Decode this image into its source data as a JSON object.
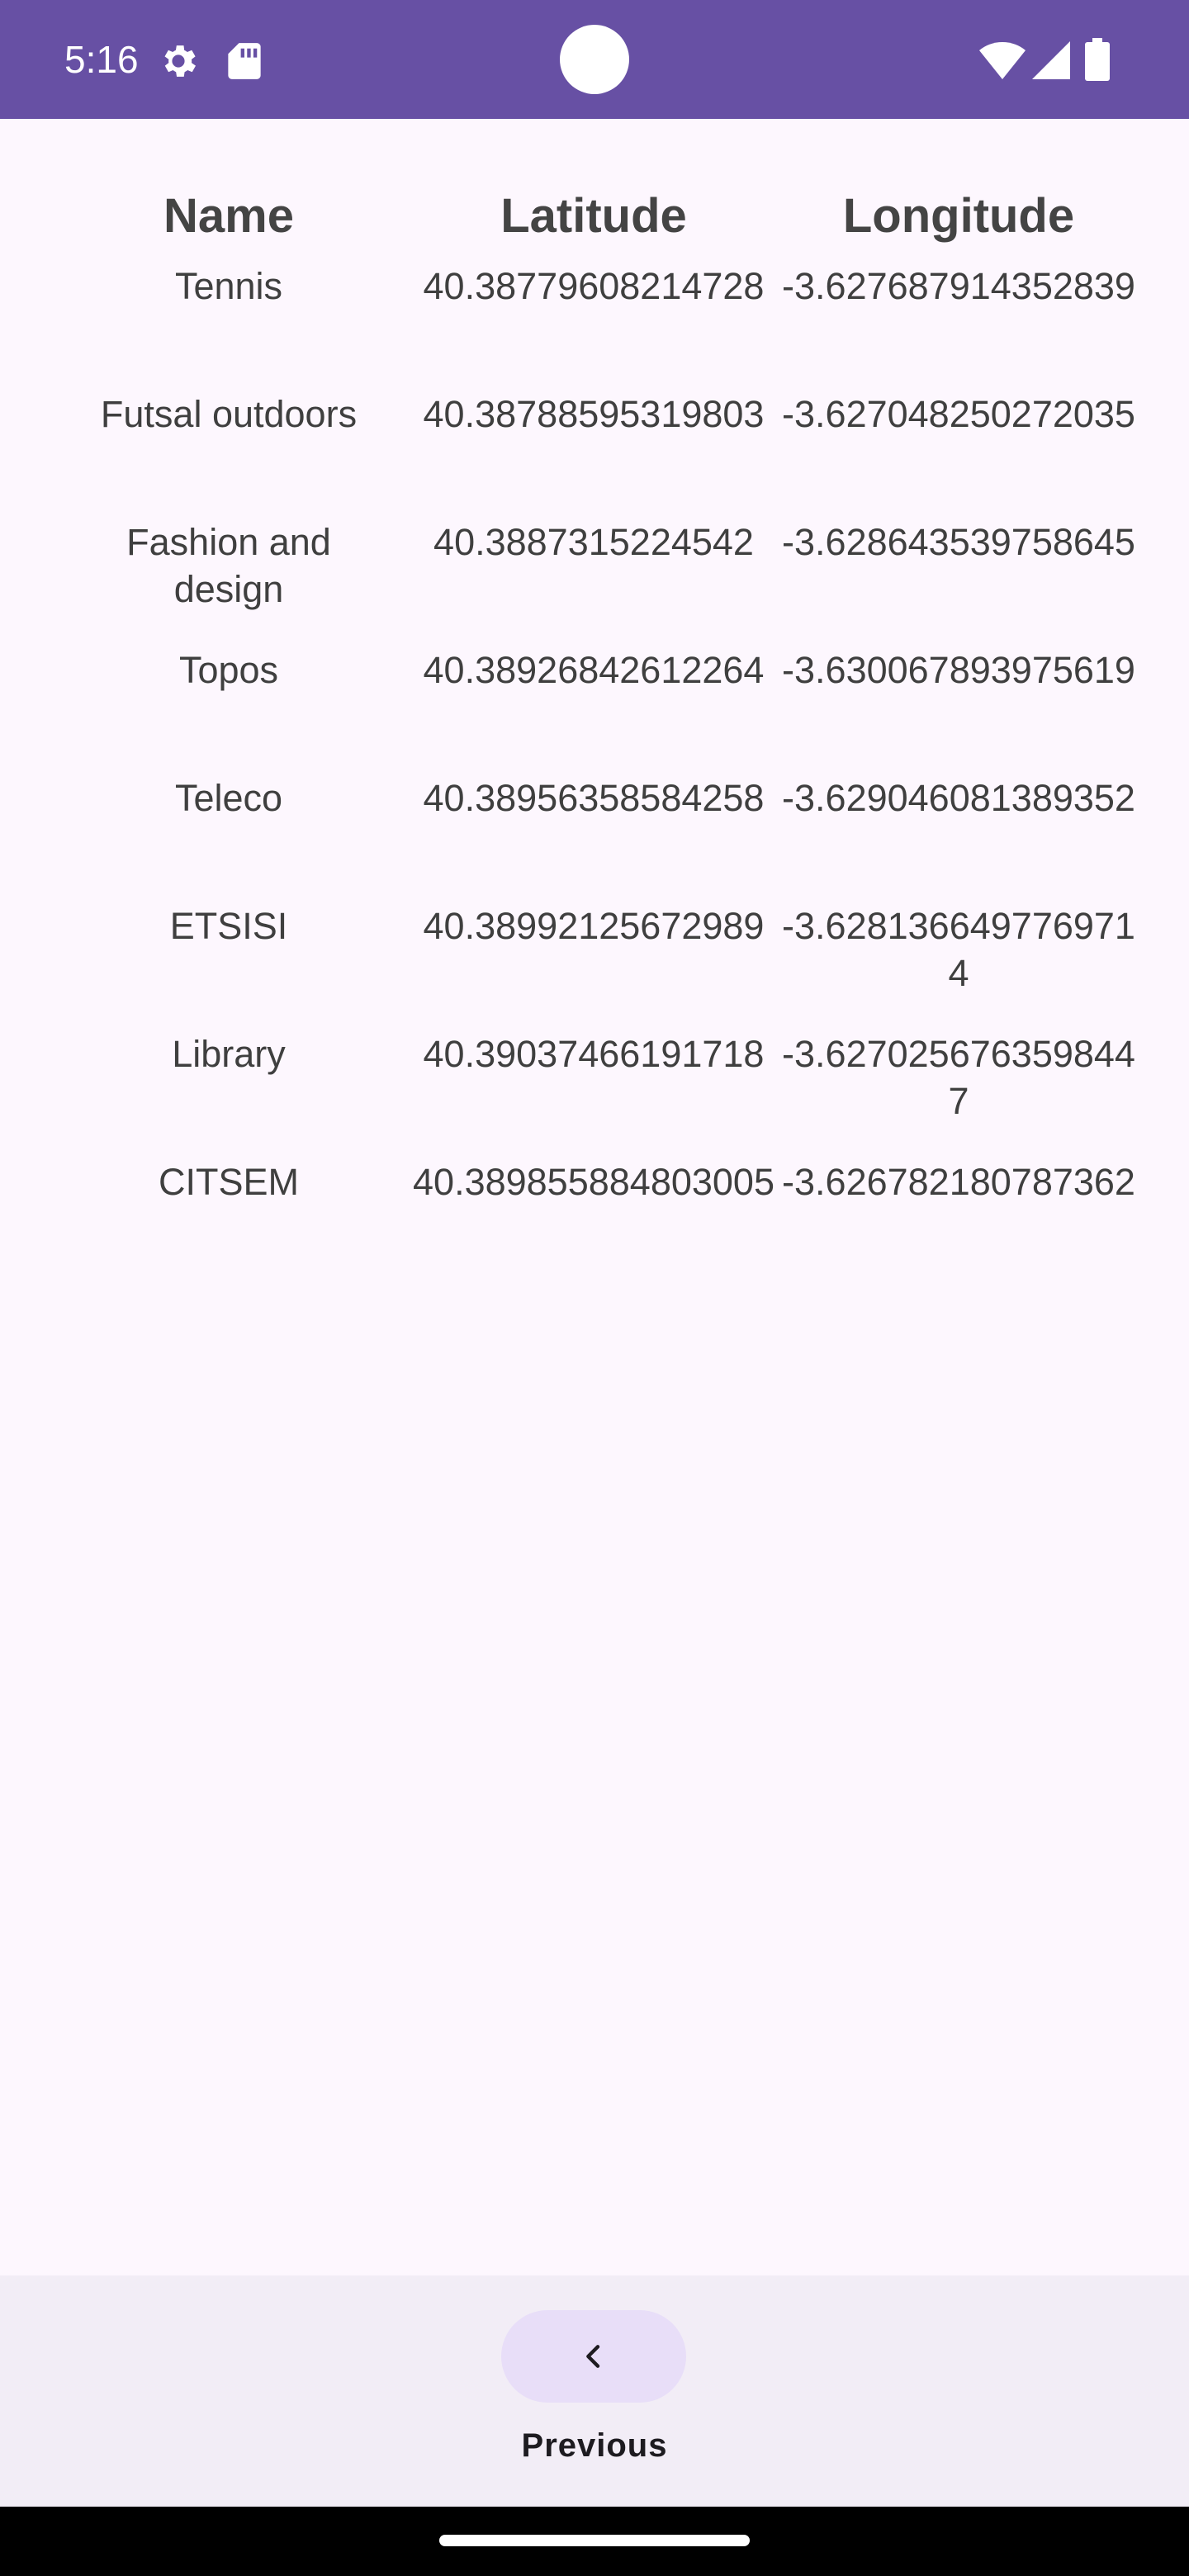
{
  "status_bar": {
    "time": "5:16",
    "icons": [
      "gear-icon",
      "sd-card-icon",
      "wifi-icon",
      "signal-icon",
      "battery-icon"
    ],
    "background": "#6750A4"
  },
  "table": {
    "headers": [
      "Name",
      "Latitude",
      "Longitude"
    ],
    "rows": [
      {
        "name": "Tennis",
        "latitude": "40.38779608214728",
        "longitude": "-3.627687914352839"
      },
      {
        "name": "Futsal outdoors",
        "latitude": "40.38788595319803",
        "longitude": "-3.627048250272035"
      },
      {
        "name": "Fashion and design",
        "latitude": "40.3887315224542",
        "longitude": "-3.628643539758645"
      },
      {
        "name": "Topos",
        "latitude": "40.38926842612264",
        "longitude": "-3.630067893975619"
      },
      {
        "name": "Teleco",
        "latitude": "40.38956358584258",
        "longitude": "-3.629046081389352"
      },
      {
        "name": "ETSISI",
        "latitude": "40.38992125672989",
        "longitude": "-3.6281366497769714"
      },
      {
        "name": "Library",
        "latitude": "40.39037466191718",
        "longitude": "-3.6270256763598447"
      },
      {
        "name": "CITSEM",
        "latitude": "40.389855884803005",
        "longitude": "-3.626782180787362"
      }
    ]
  },
  "bottom_nav": {
    "previous_label": "Previous",
    "previous_icon": "chevron-left-icon"
  }
}
